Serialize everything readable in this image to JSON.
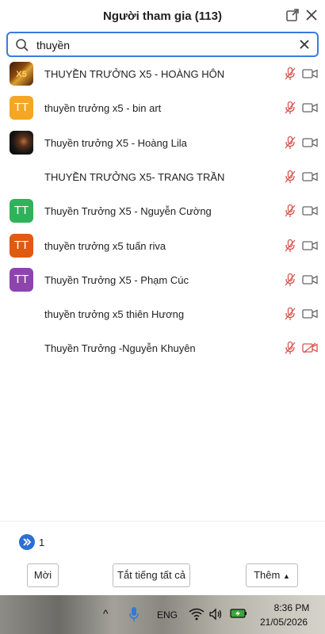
{
  "header": {
    "title": "Người tham gia (113)",
    "popout_icon": "popout-icon",
    "close_icon": "close-icon"
  },
  "search": {
    "value": "thuyền",
    "icon": "search-icon",
    "clear_icon": "clear-icon"
  },
  "participants": [
    {
      "name": "THUYỀN TRƯỞNG X5 - HOÀNG HÔN",
      "avatar_type": "image",
      "avatar_text": "X5",
      "mic": "muted",
      "camera": "off"
    },
    {
      "name": "thuyền trưởng x5 - bin art",
      "avatar_type": "initials",
      "avatar_text": "TT",
      "avatar_color": "#f5a623",
      "mic": "muted",
      "camera": "off"
    },
    {
      "name": "Thuyền trưởng X5 - Hoàng Lila",
      "avatar_type": "image",
      "avatar_text": "",
      "mic": "muted",
      "camera": "off"
    },
    {
      "name": "THUYỀN TRƯỞNG X5- TRANG TRẦN",
      "avatar_type": "none",
      "mic": "muted",
      "camera": "off"
    },
    {
      "name": "Thuyền Trưởng X5 - Nguyễn Cường",
      "avatar_type": "initials",
      "avatar_text": "TT",
      "avatar_color": "#2fb35a",
      "mic": "muted",
      "camera": "off"
    },
    {
      "name": "thuyền trưởng x5 tuấn riva",
      "avatar_type": "initials",
      "avatar_text": "TT",
      "avatar_color": "#e05a12",
      "mic": "muted",
      "camera": "off"
    },
    {
      "name": "Thuyền Trưởng X5 - Phạm Cúc",
      "avatar_type": "initials",
      "avatar_text": "TT",
      "avatar_color": "#8e44ad",
      "mic": "muted",
      "camera": "off"
    },
    {
      "name": "thuyền trưởng x5 thiên Hương",
      "avatar_type": "none",
      "mic": "muted",
      "camera": "off"
    },
    {
      "name": "Thuyền Trưởng -Nguyễn Khuyên",
      "avatar_type": "none",
      "mic": "muted",
      "camera": "off-muted"
    }
  ],
  "pagination": {
    "current_page": "1"
  },
  "footer": {
    "invite_label": "Mời",
    "mute_all_label": "Tắt tiếng tất cả",
    "more_label": "Thêm"
  },
  "taskbar": {
    "language": "ENG",
    "time": "8:36 PM",
    "date": "21/05/2026"
  },
  "colors": {
    "accent": "#3c7ae0",
    "muted_red": "#d9534f",
    "page_button": "#2b6fd6"
  }
}
